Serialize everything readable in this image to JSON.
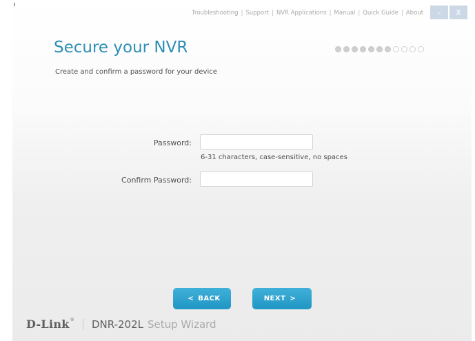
{
  "top_nav": {
    "links": [
      "Troubleshooting",
      "Support",
      "NVR Applications",
      "Manual",
      "Quick Guide",
      "About"
    ],
    "separator": "|"
  },
  "window_controls": {
    "minimize": "–",
    "close": "X"
  },
  "page": {
    "title": "Secure your NVR",
    "subtitle": "Create and confirm a password for your device"
  },
  "progress": {
    "current_step": 7,
    "total_steps": 11
  },
  "form": {
    "password_label": "Password:",
    "password_value": "",
    "password_hint": "6-31 characters, case-sensitive, no spaces",
    "confirm_label": "Confirm Password:",
    "confirm_value": ""
  },
  "buttons": {
    "back_arrow": "<",
    "back_label": "BACK",
    "next_label": "NEXT",
    "next_arrow": ">"
  },
  "footer": {
    "logo": "D-Link",
    "logo_mark": "®",
    "model": "DNR-202L",
    "wizard": "Setup Wizard"
  },
  "colors": {
    "accent": "#2e8eb5",
    "button": "#2a9fcc",
    "window_button": "#cdd8e6"
  }
}
